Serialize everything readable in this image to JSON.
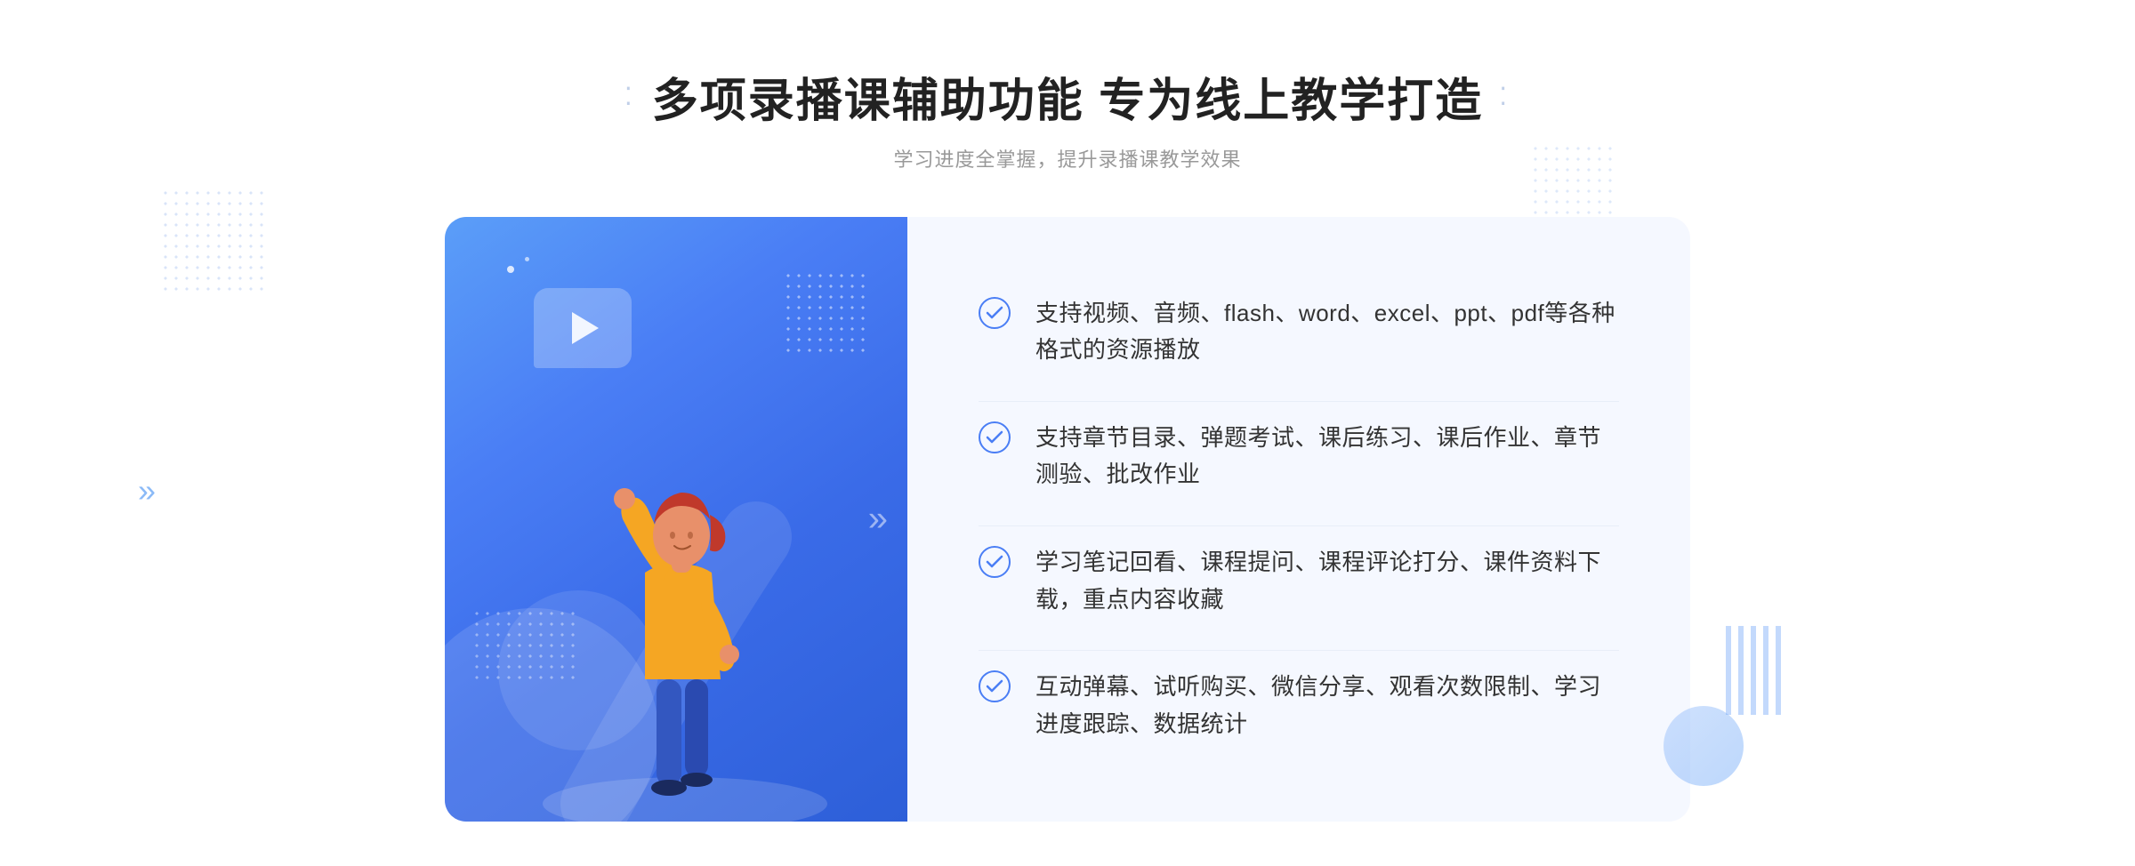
{
  "header": {
    "title_dots_left": "⁚",
    "title_dots_right": "⁚",
    "main_title": "多项录播课辅助功能 专为线上教学打造",
    "subtitle": "学习进度全掌握，提升录播课教学效果"
  },
  "features": [
    {
      "id": "feature-1",
      "text": "支持视频、音频、flash、word、excel、ppt、pdf等各种格式的资源播放"
    },
    {
      "id": "feature-2",
      "text": "支持章节目录、弹题考试、课后练习、课后作业、章节测验、批改作业"
    },
    {
      "id": "feature-3",
      "text": "学习笔记回看、课程提问、课程评论打分、课件资料下载，重点内容收藏"
    },
    {
      "id": "feature-4",
      "text": "互动弹幕、试听购买、微信分享、观看次数限制、学习进度跟踪、数据统计"
    }
  ],
  "colors": {
    "accent_blue": "#4a7ef5",
    "light_blue": "#f5f8ff",
    "check_color": "#4a7ef5"
  }
}
